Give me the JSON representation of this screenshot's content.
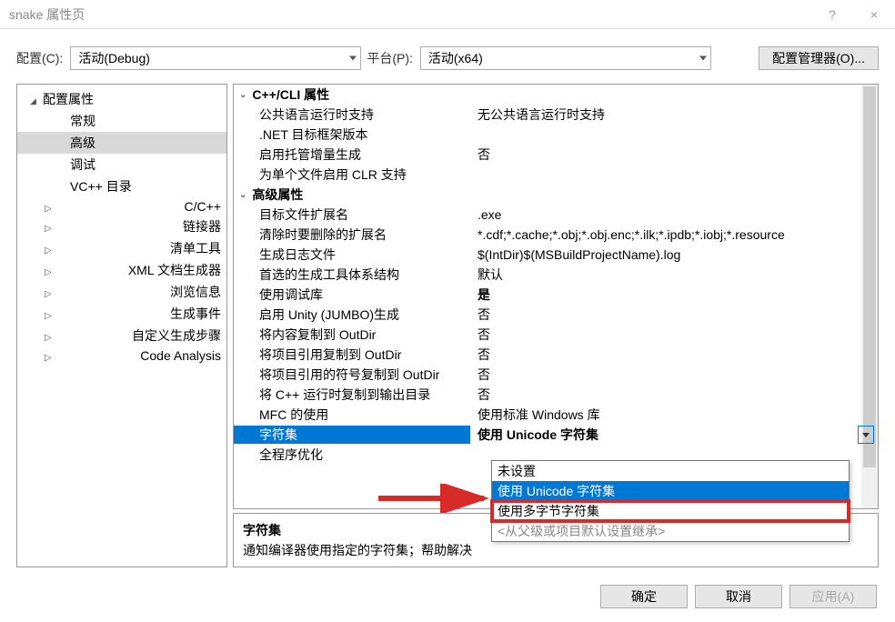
{
  "window": {
    "title": "snake 属性页",
    "help": "?",
    "close": "×"
  },
  "toolbar": {
    "config_label": "配置(C):",
    "config_value": "活动(Debug)",
    "platform_label": "平台(P):",
    "platform_value": "活动(x64)",
    "manager_btn": "配置管理器(O)..."
  },
  "tree": [
    {
      "label": "配置属性",
      "level": 1,
      "expand": "down"
    },
    {
      "label": "常规",
      "level": 2,
      "expand": "none"
    },
    {
      "label": "高级",
      "level": 2,
      "expand": "none",
      "selected": true
    },
    {
      "label": "调试",
      "level": 2,
      "expand": "none"
    },
    {
      "label": "VC++ 目录",
      "level": 2,
      "expand": "none"
    },
    {
      "label": "C/C++",
      "level": 2,
      "expand": "right"
    },
    {
      "label": "链接器",
      "level": 2,
      "expand": "right"
    },
    {
      "label": "清单工具",
      "level": 2,
      "expand": "right"
    },
    {
      "label": "XML 文档生成器",
      "level": 2,
      "expand": "right"
    },
    {
      "label": "浏览信息",
      "level": 2,
      "expand": "right"
    },
    {
      "label": "生成事件",
      "level": 2,
      "expand": "right"
    },
    {
      "label": "自定义生成步骤",
      "level": 2,
      "expand": "right"
    },
    {
      "label": "Code Analysis",
      "level": 2,
      "expand": "right"
    }
  ],
  "groups": [
    {
      "title": "C++/CLI 属性",
      "rows": [
        {
          "label": "公共语言运行时支持",
          "value": "无公共语言运行时支持"
        },
        {
          "label": ".NET 目标框架版本",
          "value": ""
        },
        {
          "label": "启用托管增量生成",
          "value": "否"
        },
        {
          "label": "为单个文件启用 CLR 支持",
          "value": ""
        }
      ]
    },
    {
      "title": "高级属性",
      "rows": [
        {
          "label": "目标文件扩展名",
          "value": ".exe"
        },
        {
          "label": "清除时要删除的扩展名",
          "value": "*.cdf;*.cache;*.obj;*.obj.enc;*.ilk;*.ipdb;*.iobj;*.resource"
        },
        {
          "label": "生成日志文件",
          "value": "$(IntDir)$(MSBuildProjectName).log"
        },
        {
          "label": "首选的生成工具体系结构",
          "value": "默认"
        },
        {
          "label": "使用调试库",
          "value": "是",
          "bold": true
        },
        {
          "label": "启用 Unity (JUMBO)生成",
          "value": "否"
        },
        {
          "label": "将内容复制到 OutDir",
          "value": "否"
        },
        {
          "label": "将项目引用复制到 OutDir",
          "value": "否"
        },
        {
          "label": "将项目引用的符号复制到 OutDir",
          "value": "否"
        },
        {
          "label": "将 C++ 运行时复制到输出目录",
          "value": "否"
        },
        {
          "label": "MFC 的使用",
          "value": "使用标准 Windows 库"
        },
        {
          "label": "字符集",
          "value": "使用 Unicode 字符集",
          "selected": true,
          "bold": true
        },
        {
          "label": "全程序优化",
          "value": ""
        }
      ]
    }
  ],
  "dropdown": {
    "options": [
      {
        "label": "未设置"
      },
      {
        "label": "使用 Unicode 字符集",
        "hi": true
      },
      {
        "label": "使用多字节字符集",
        "boxed": true
      },
      {
        "label": "<从父级或项目默认设置继承>",
        "inherit": true
      }
    ]
  },
  "desc": {
    "title": "字符集",
    "text": "通知编译器使用指定的字符集；帮助解决"
  },
  "footer": {
    "ok": "确定",
    "cancel": "取消",
    "apply": "应用(A)"
  }
}
